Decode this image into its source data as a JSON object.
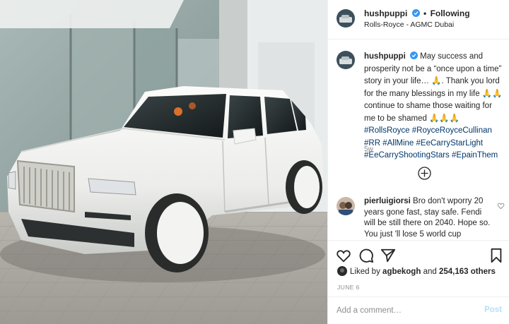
{
  "post": {
    "photo": {
      "subject": "white-suv-photo"
    },
    "header": {
      "username": "hushpuppi",
      "follow_label": "Following",
      "separator": "•",
      "location": "Rolls-Royce - AGMC Dubai"
    },
    "caption": {
      "username": "hushpuppi",
      "text": "May success and prosperity not be a “once upon a time” story in your life… 🙏. Thank you lord for the many blessings in my life 🙏🙏 continue to shame those waiting for me to be shamed 🙏🙏🙏 ",
      "hashtags": [
        "#RollsRoyce",
        "#RoyceRoyceCullinan",
        "#RR",
        "#AllMine",
        "#EeCarryStarLight",
        "#EeCarryShootingStars",
        "#EpainThem"
      ],
      "age": "5w"
    },
    "comment": {
      "username": "pierluigiorsi",
      "text": "Bro don't wporry 20 years gone fast, stay safe. Fendi will be still there on 2040. Hope so. You just 'll lose 5 world cup"
    },
    "likes": {
      "prefix": "Liked by",
      "user": "agbekogh",
      "middle": "and",
      "count": "254,163 others"
    },
    "date": "JUNE 6",
    "add_comment": {
      "placeholder": "Add a comment…",
      "post_label": "Post"
    },
    "colors": {
      "verified": "#3897f0",
      "hashtag": "#00376b",
      "post_disabled": "#b2dffc",
      "muted": "#8e8e8e"
    },
    "icons": [
      "verified-icon",
      "heart-icon",
      "comment-icon",
      "share-icon",
      "bookmark-icon",
      "load-more-icon",
      "comment-like-icon"
    ]
  }
}
